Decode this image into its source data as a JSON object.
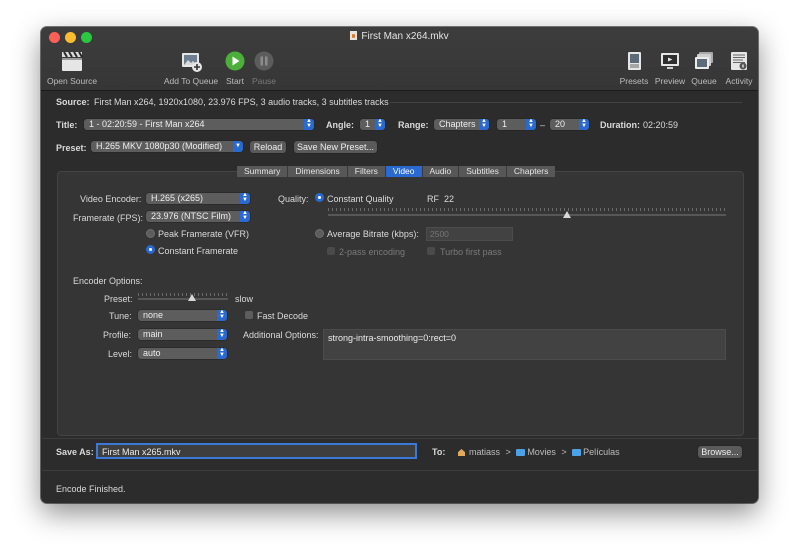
{
  "window": {
    "title": "First Man x264.mkv"
  },
  "colors": {
    "accent": "#2a69cf",
    "start_green": "#4caf3a",
    "close": "#fe5f57",
    "minimize": "#febc2e",
    "zoom": "#28c840"
  },
  "toolbar": {
    "open_source": "Open Source",
    "add_to_queue": "Add To Queue",
    "start": "Start",
    "pause": "Pause",
    "presets": "Presets",
    "preview": "Preview",
    "queue": "Queue",
    "activity": "Activity"
  },
  "source": {
    "label": "Source:",
    "value": "First Man x264, 1920x1080, 23.976 FPS, 3 audio tracks, 3 subtitles tracks"
  },
  "title_row": {
    "title_label": "Title:",
    "title_value": "1 - 02:20:59 - First Man x264",
    "angle_label": "Angle:",
    "angle_value": "1",
    "range_label": "Range:",
    "range_type": "Chapters",
    "range_start": "1",
    "range_dash": "–",
    "range_end": "20",
    "duration_label": "Duration:",
    "duration_value": "02:20:59"
  },
  "preset_row": {
    "label": "Preset:",
    "value": "H.265 MKV 1080p30 (Modified)",
    "reload": "Reload",
    "save_new": "Save New Preset..."
  },
  "tabs": [
    {
      "label": "Summary",
      "active": false
    },
    {
      "label": "Dimensions",
      "active": false
    },
    {
      "label": "Filters",
      "active": false
    },
    {
      "label": "Video",
      "active": true
    },
    {
      "label": "Audio",
      "active": false
    },
    {
      "label": "Subtitles",
      "active": false
    },
    {
      "label": "Chapters",
      "active": false
    }
  ],
  "video": {
    "encoder_label": "Video Encoder:",
    "encoder_value": "H.265 (x265)",
    "framerate_label": "Framerate (FPS):",
    "framerate_value": "23.976 (NTSC Film)",
    "peak_framerate": "Peak Framerate (VFR)",
    "constant_framerate": "Constant Framerate",
    "quality_label": "Quality:",
    "constant_quality": "Constant Quality",
    "rf_label": "RF",
    "rf_value": "22",
    "average_bitrate": "Average Bitrate (kbps):",
    "bitrate_placeholder": "2500",
    "two_pass": "2-pass encoding",
    "turbo_first_pass": "Turbo first pass",
    "quality_slider_fraction": 0.6
  },
  "encoder_options": {
    "heading": "Encoder Options:",
    "preset_label": "Preset:",
    "preset_value": "slow",
    "preset_slider_fraction": 0.6,
    "tune_label": "Tune:",
    "tune_value": "none",
    "fast_decode": "Fast Decode",
    "profile_label": "Profile:",
    "profile_value": "main",
    "level_label": "Level:",
    "level_value": "auto",
    "additional_label": "Additional Options:",
    "additional_value": "strong-intra-smoothing=0:rect=0"
  },
  "save": {
    "label": "Save As:",
    "filename": "First Man x265.mkv",
    "to_label": "To:",
    "path": [
      "matiass",
      "Movies",
      "Películas"
    ],
    "separator": ">",
    "browse": "Browse..."
  },
  "status": {
    "text": "Encode Finished."
  }
}
